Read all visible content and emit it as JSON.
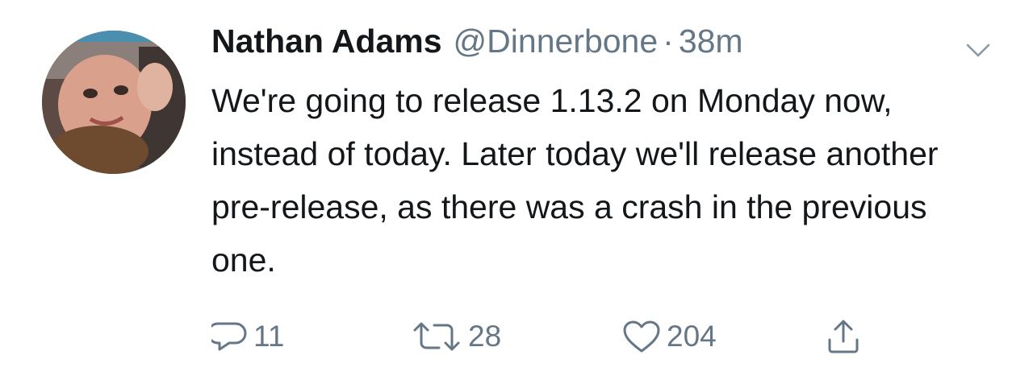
{
  "tweet": {
    "display_name": "Nathan Adams",
    "handle": "@Dinnerbone",
    "separator": "·",
    "timestamp": "38m",
    "text": "We're going to release 1.13.2 on Monday now, instead of today. Later today we'll release another pre-release, as there was a crash in the previous one.",
    "actions": {
      "reply_count": "11",
      "retweet_count": "28",
      "like_count": "204"
    }
  },
  "icons": {
    "avatar": "avatar-photo",
    "menu": "chevron-down-icon",
    "reply": "reply-bubble-icon",
    "retweet": "retweet-arrows-icon",
    "like": "heart-outline-icon",
    "share": "share-upload-icon"
  },
  "colors": {
    "primary_text": "#14171a",
    "secondary_text": "#657786",
    "background": "#ffffff"
  }
}
